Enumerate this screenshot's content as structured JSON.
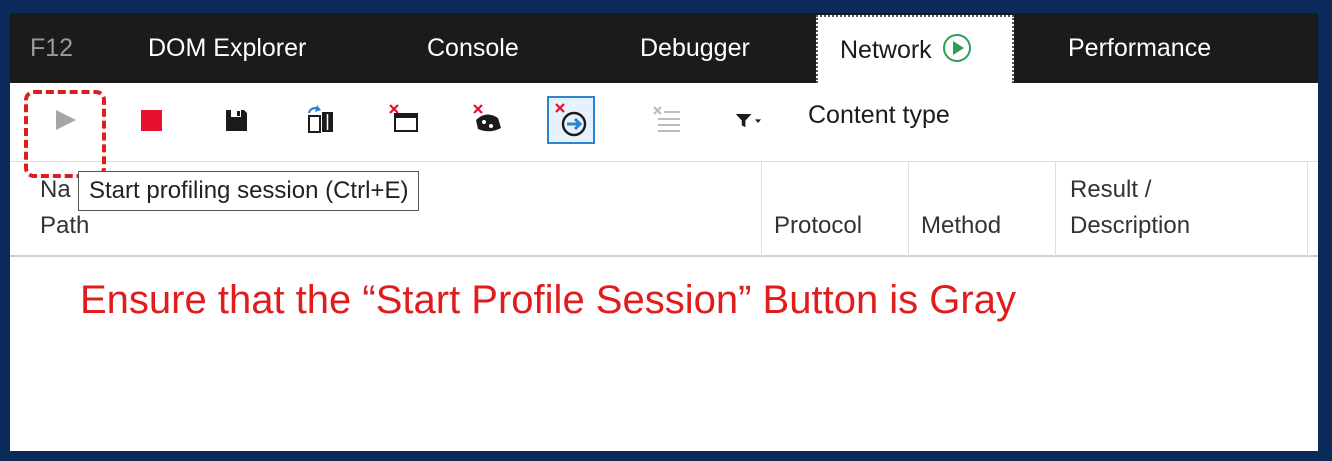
{
  "tabs": {
    "f12": "F12",
    "dom_explorer": "DOM Explorer",
    "console": "Console",
    "debugger": "Debugger",
    "network": "Network",
    "performance": "Performance"
  },
  "toolbar": {
    "buttons": [
      {
        "icon": "play-icon",
        "state": "disabled"
      },
      {
        "icon": "stop-icon"
      },
      {
        "icon": "save-icon"
      },
      {
        "icon": "import-icon"
      },
      {
        "icon": "clear-session-icon"
      },
      {
        "icon": "clear-cache-icon"
      },
      {
        "icon": "clear-on-navigate-icon",
        "state": "active"
      },
      {
        "icon": "clear-entries-icon"
      }
    ],
    "filter_label": "Content type"
  },
  "tooltip": "Start profiling session (Ctrl+E)",
  "columns": {
    "name_line1": "Na",
    "name_line2": "Path",
    "protocol": "Protocol",
    "method": "Method",
    "result_line1": "Result /",
    "result_line2": "Description"
  },
  "annotation": "Ensure that the “Start Profile Session” Button is Gray",
  "colors": {
    "tabbar_bg": "#1b1b1b",
    "annotation": "#e01d1d",
    "stop": "#e8112d",
    "accent_blue": "#2a84d6",
    "network_play": "#2f9e52"
  }
}
